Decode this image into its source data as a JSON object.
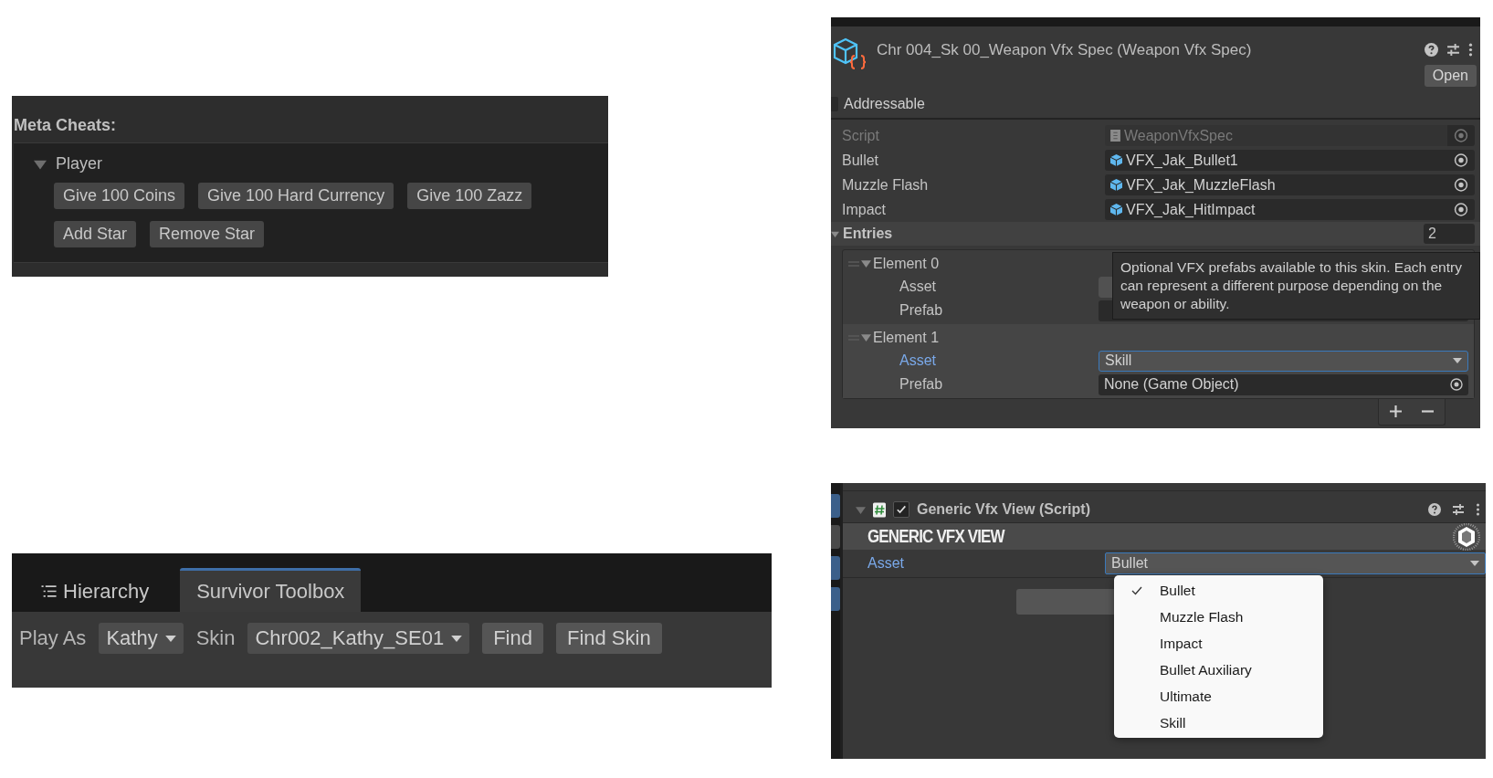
{
  "meta_cheats": {
    "title": "Meta Cheats:",
    "group": {
      "label": "Player",
      "expanded": true,
      "buttons": [
        [
          "Give 100 Coins",
          "Give 100 Hard Currency",
          "Give 100 Zazz"
        ],
        [
          "Add Star",
          "Remove Star"
        ]
      ]
    }
  },
  "inspector": {
    "title": "Chr 004_Sk 00_Weapon Vfx Spec (Weapon Vfx Spec)",
    "open_button": "Open",
    "addressable": {
      "label": "Addressable",
      "checked": false
    },
    "fields": [
      {
        "label": "Script",
        "value": "WeaponVfxSpec",
        "kind": "script",
        "disabled": true
      },
      {
        "label": "Bullet",
        "value": "VFX_Jak_Bullet1",
        "kind": "prefab",
        "disabled": false
      },
      {
        "label": "Muzzle Flash",
        "value": "VFX_Jak_MuzzleFlash",
        "kind": "prefab",
        "disabled": false
      },
      {
        "label": "Impact",
        "value": "VFX_Jak_HitImpact",
        "kind": "prefab",
        "disabled": false
      }
    ],
    "entries": {
      "label": "Entries",
      "count": "2",
      "expanded": true,
      "elements": [
        {
          "label": "Element 0",
          "expanded": true,
          "rows": [
            {
              "label": "Asset",
              "kind": "dropdown",
              "focused": false
            },
            {
              "label": "Prefab",
              "kind": "object",
              "focused": false
            }
          ]
        },
        {
          "label": "Element 1",
          "expanded": true,
          "rows": [
            {
              "label": "Asset",
              "kind": "dropdown",
              "value": "Skill",
              "focused": true
            },
            {
              "label": "Prefab",
              "kind": "object",
              "value": "None (Game Object)",
              "focused": false
            }
          ]
        }
      ]
    },
    "tooltip": "Optional VFX prefabs available to this skin. Each entry can represent a different purpose depending on the weapon or ability."
  },
  "toolbox": {
    "tabs": [
      {
        "label": "Hierarchy",
        "selected": false
      },
      {
        "label": "Survivor Toolbox",
        "selected": true
      }
    ],
    "play_as": {
      "label": "Play As",
      "value": "Kathy"
    },
    "skin": {
      "label": "Skin",
      "value": "Chr002_Kathy_SE01"
    },
    "buttons": [
      "Find",
      "Find Skin"
    ]
  },
  "component": {
    "title": "Generic Vfx View (Script)",
    "enabled": true,
    "expanded": true,
    "header": "GENERIC VFX VIEW",
    "asset": {
      "label": "Asset",
      "value": "Bullet"
    },
    "menu": [
      {
        "label": "Bullet",
        "selected": true
      },
      {
        "label": "Muzzle Flash",
        "selected": false
      },
      {
        "label": "Impact",
        "selected": false
      },
      {
        "label": "Bullet Auxiliary",
        "selected": false
      },
      {
        "label": "Ultimate",
        "selected": false
      },
      {
        "label": "Skill",
        "selected": false
      }
    ]
  }
}
